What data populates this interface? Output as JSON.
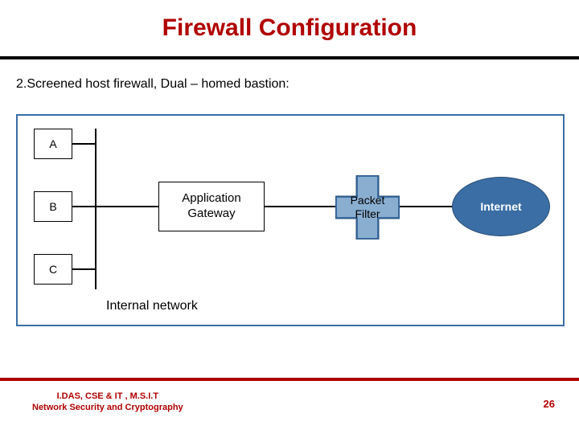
{
  "title": "Firewall Configuration",
  "subtitle": "2.Screened host firewall, Dual – homed bastion:",
  "hosts": {
    "a": "A",
    "b": "B",
    "c": "C"
  },
  "gateway": "Application\nGateway",
  "filter": "Packet\nFilter",
  "internet": "Internet",
  "internal": "Internal network",
  "footer": {
    "line1": "I.DAS, CSE & IT , M.S.I.T",
    "line2": "Network Security and Cryptography"
  },
  "page": "26"
}
